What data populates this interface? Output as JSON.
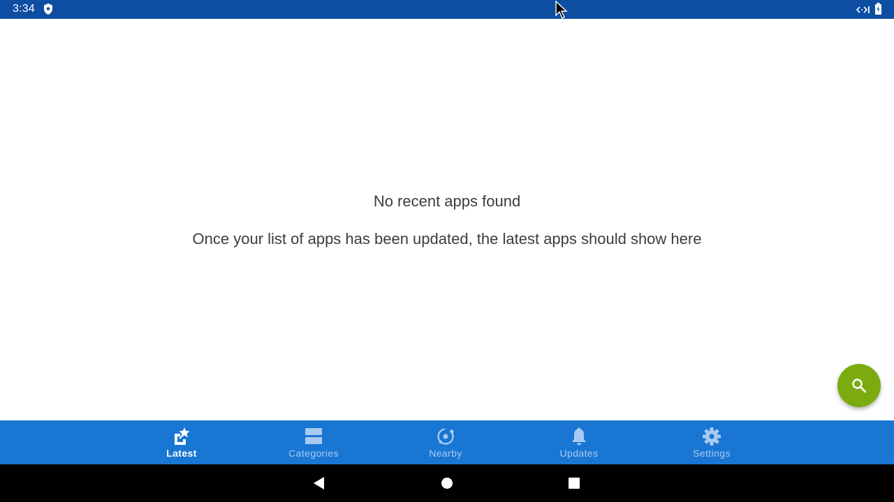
{
  "status_bar": {
    "time": "3:34",
    "icons": [
      "shield-icon",
      "network-icon",
      "battery-icon"
    ]
  },
  "main": {
    "empty_title": "No recent apps found",
    "empty_message": "Once your list of apps has been updated, the latest apps should show here"
  },
  "fab": {
    "icon": "search-icon",
    "color": "#7cab10"
  },
  "bottom_nav": {
    "background": "#1976d2",
    "active_index": 0,
    "items": [
      {
        "label": "Latest",
        "icon": "latest-star-icon"
      },
      {
        "label": "Categories",
        "icon": "categories-icon"
      },
      {
        "label": "Nearby",
        "icon": "nearby-icon"
      },
      {
        "label": "Updates",
        "icon": "bell-icon"
      },
      {
        "label": "Settings",
        "icon": "gear-icon"
      }
    ]
  },
  "system_nav": {
    "buttons": [
      "back-icon",
      "home-icon",
      "recents-icon"
    ]
  }
}
